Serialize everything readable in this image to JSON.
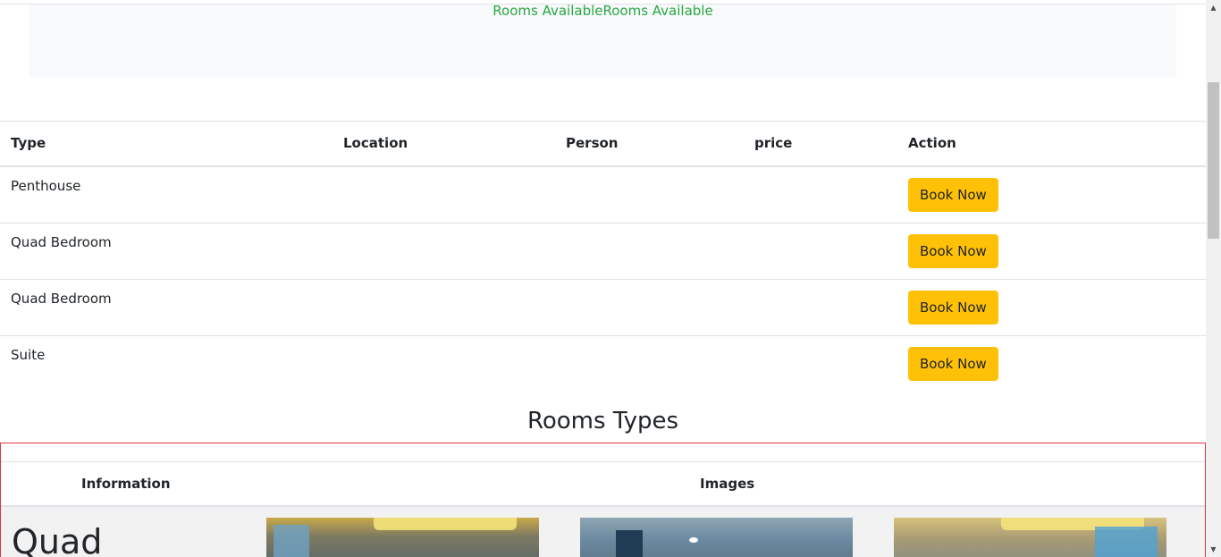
{
  "availability": {
    "text": "Rooms AvailableRooms Available"
  },
  "rooms_table": {
    "headers": [
      "Type",
      "Location",
      "Person",
      "price",
      "Action"
    ],
    "rows": [
      {
        "type": "Penthouse",
        "location": "",
        "person": "",
        "price": "",
        "action": "Book Now"
      },
      {
        "type": "Quad Bedroom",
        "location": "",
        "person": "",
        "price": "",
        "action": "Book Now"
      },
      {
        "type": "Quad Bedroom",
        "location": "",
        "person": "",
        "price": "",
        "action": "Book Now"
      },
      {
        "type": "Suite",
        "location": "",
        "person": "",
        "price": "",
        "action": "Book Now"
      }
    ]
  },
  "room_types": {
    "title": "Rooms Types",
    "headers": {
      "information": "Information",
      "images": "Images"
    },
    "first_row": {
      "name": "Quad"
    }
  },
  "colors": {
    "availability_text": "#28a745",
    "book_button": "#ffc107",
    "room_types_border": "#dc3545"
  },
  "icons": {
    "scroll_up": "triangle-up",
    "scroll_down": "triangle-down"
  }
}
